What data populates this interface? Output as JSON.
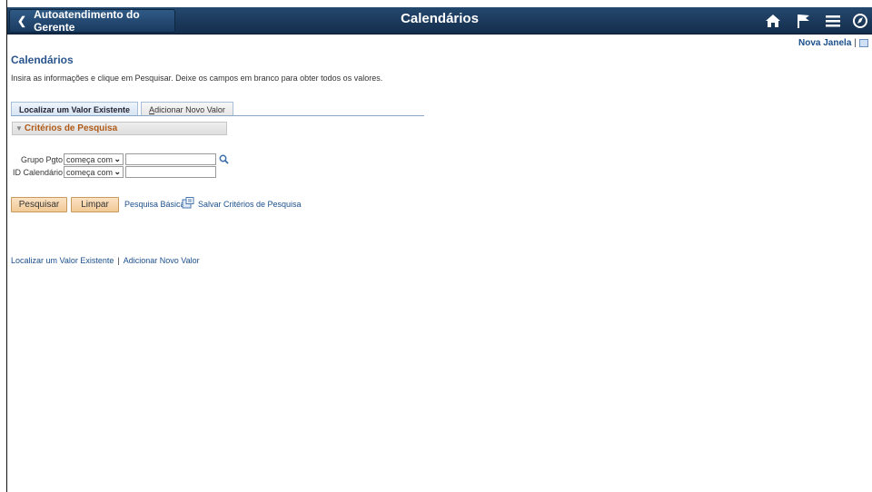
{
  "banner": {
    "back_label": "Autoatendimento do Gerente",
    "title": "Calendários",
    "icons": [
      "home-icon",
      "flag-icon",
      "menu-icon",
      "navbar-icon"
    ]
  },
  "header_links": {
    "new_window": "Nova Janela",
    "separator": "|"
  },
  "page": {
    "title": "Calendários",
    "instructions": "Insira as informações e clique em Pesquisar. Deixe os campos em branco para obter todos os valores."
  },
  "tabs": {
    "find": "Localizar um Valor Existente",
    "add_prefix": "A",
    "add_rest": "dicionar Novo Valor"
  },
  "criteria": {
    "header": "Critérios de Pesquisa",
    "fields": [
      {
        "label": "Grupo Pgto",
        "operator": "começa com",
        "value": ""
      },
      {
        "label": "ID Calendário",
        "operator": "começa com",
        "value": ""
      }
    ]
  },
  "actions": {
    "search": "Pesquisar",
    "clear": "Limpar",
    "basic_search": "Pesquisa Básica",
    "save_criteria": "Salvar Critérios de Pesquisa"
  },
  "footer_links": {
    "find": "Localizar um Valor Existente",
    "separator": "|",
    "add": "Adicionar Novo Valor"
  },
  "colors": {
    "banner": "#1b3b60",
    "link": "#1b4f8c",
    "button": "#f2c996",
    "section_header_text": "#b05a18"
  }
}
